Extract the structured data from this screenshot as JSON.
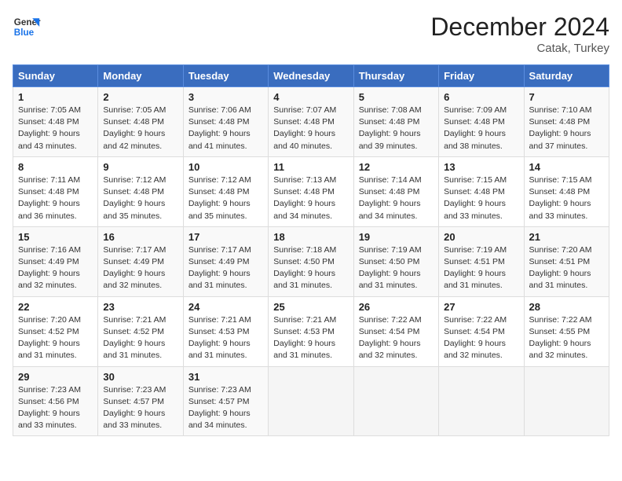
{
  "logo": {
    "line1": "General",
    "line2": "Blue"
  },
  "title": "December 2024",
  "subtitle": "Catak, Turkey",
  "days_header": [
    "Sunday",
    "Monday",
    "Tuesday",
    "Wednesday",
    "Thursday",
    "Friday",
    "Saturday"
  ],
  "weeks": [
    [
      {
        "day": "1",
        "sunrise": "7:05 AM",
        "sunset": "4:48 PM",
        "daylight": "9 hours and 43 minutes."
      },
      {
        "day": "2",
        "sunrise": "7:05 AM",
        "sunset": "4:48 PM",
        "daylight": "9 hours and 42 minutes."
      },
      {
        "day": "3",
        "sunrise": "7:06 AM",
        "sunset": "4:48 PM",
        "daylight": "9 hours and 41 minutes."
      },
      {
        "day": "4",
        "sunrise": "7:07 AM",
        "sunset": "4:48 PM",
        "daylight": "9 hours and 40 minutes."
      },
      {
        "day": "5",
        "sunrise": "7:08 AM",
        "sunset": "4:48 PM",
        "daylight": "9 hours and 39 minutes."
      },
      {
        "day": "6",
        "sunrise": "7:09 AM",
        "sunset": "4:48 PM",
        "daylight": "9 hours and 38 minutes."
      },
      {
        "day": "7",
        "sunrise": "7:10 AM",
        "sunset": "4:48 PM",
        "daylight": "9 hours and 37 minutes."
      }
    ],
    [
      {
        "day": "8",
        "sunrise": "7:11 AM",
        "sunset": "4:48 PM",
        "daylight": "9 hours and 36 minutes."
      },
      {
        "day": "9",
        "sunrise": "7:12 AM",
        "sunset": "4:48 PM",
        "daylight": "9 hours and 35 minutes."
      },
      {
        "day": "10",
        "sunrise": "7:12 AM",
        "sunset": "4:48 PM",
        "daylight": "9 hours and 35 minutes."
      },
      {
        "day": "11",
        "sunrise": "7:13 AM",
        "sunset": "4:48 PM",
        "daylight": "9 hours and 34 minutes."
      },
      {
        "day": "12",
        "sunrise": "7:14 AM",
        "sunset": "4:48 PM",
        "daylight": "9 hours and 34 minutes."
      },
      {
        "day": "13",
        "sunrise": "7:15 AM",
        "sunset": "4:48 PM",
        "daylight": "9 hours and 33 minutes."
      },
      {
        "day": "14",
        "sunrise": "7:15 AM",
        "sunset": "4:48 PM",
        "daylight": "9 hours and 33 minutes."
      }
    ],
    [
      {
        "day": "15",
        "sunrise": "7:16 AM",
        "sunset": "4:49 PM",
        "daylight": "9 hours and 32 minutes."
      },
      {
        "day": "16",
        "sunrise": "7:17 AM",
        "sunset": "4:49 PM",
        "daylight": "9 hours and 32 minutes."
      },
      {
        "day": "17",
        "sunrise": "7:17 AM",
        "sunset": "4:49 PM",
        "daylight": "9 hours and 31 minutes."
      },
      {
        "day": "18",
        "sunrise": "7:18 AM",
        "sunset": "4:50 PM",
        "daylight": "9 hours and 31 minutes."
      },
      {
        "day": "19",
        "sunrise": "7:19 AM",
        "sunset": "4:50 PM",
        "daylight": "9 hours and 31 minutes."
      },
      {
        "day": "20",
        "sunrise": "7:19 AM",
        "sunset": "4:51 PM",
        "daylight": "9 hours and 31 minutes."
      },
      {
        "day": "21",
        "sunrise": "7:20 AM",
        "sunset": "4:51 PM",
        "daylight": "9 hours and 31 minutes."
      }
    ],
    [
      {
        "day": "22",
        "sunrise": "7:20 AM",
        "sunset": "4:52 PM",
        "daylight": "9 hours and 31 minutes."
      },
      {
        "day": "23",
        "sunrise": "7:21 AM",
        "sunset": "4:52 PM",
        "daylight": "9 hours and 31 minutes."
      },
      {
        "day": "24",
        "sunrise": "7:21 AM",
        "sunset": "4:53 PM",
        "daylight": "9 hours and 31 minutes."
      },
      {
        "day": "25",
        "sunrise": "7:21 AM",
        "sunset": "4:53 PM",
        "daylight": "9 hours and 31 minutes."
      },
      {
        "day": "26",
        "sunrise": "7:22 AM",
        "sunset": "4:54 PM",
        "daylight": "9 hours and 32 minutes."
      },
      {
        "day": "27",
        "sunrise": "7:22 AM",
        "sunset": "4:54 PM",
        "daylight": "9 hours and 32 minutes."
      },
      {
        "day": "28",
        "sunrise": "7:22 AM",
        "sunset": "4:55 PM",
        "daylight": "9 hours and 32 minutes."
      }
    ],
    [
      {
        "day": "29",
        "sunrise": "7:23 AM",
        "sunset": "4:56 PM",
        "daylight": "9 hours and 33 minutes."
      },
      {
        "day": "30",
        "sunrise": "7:23 AM",
        "sunset": "4:57 PM",
        "daylight": "9 hours and 33 minutes."
      },
      {
        "day": "31",
        "sunrise": "7:23 AM",
        "sunset": "4:57 PM",
        "daylight": "9 hours and 34 minutes."
      },
      null,
      null,
      null,
      null
    ]
  ]
}
